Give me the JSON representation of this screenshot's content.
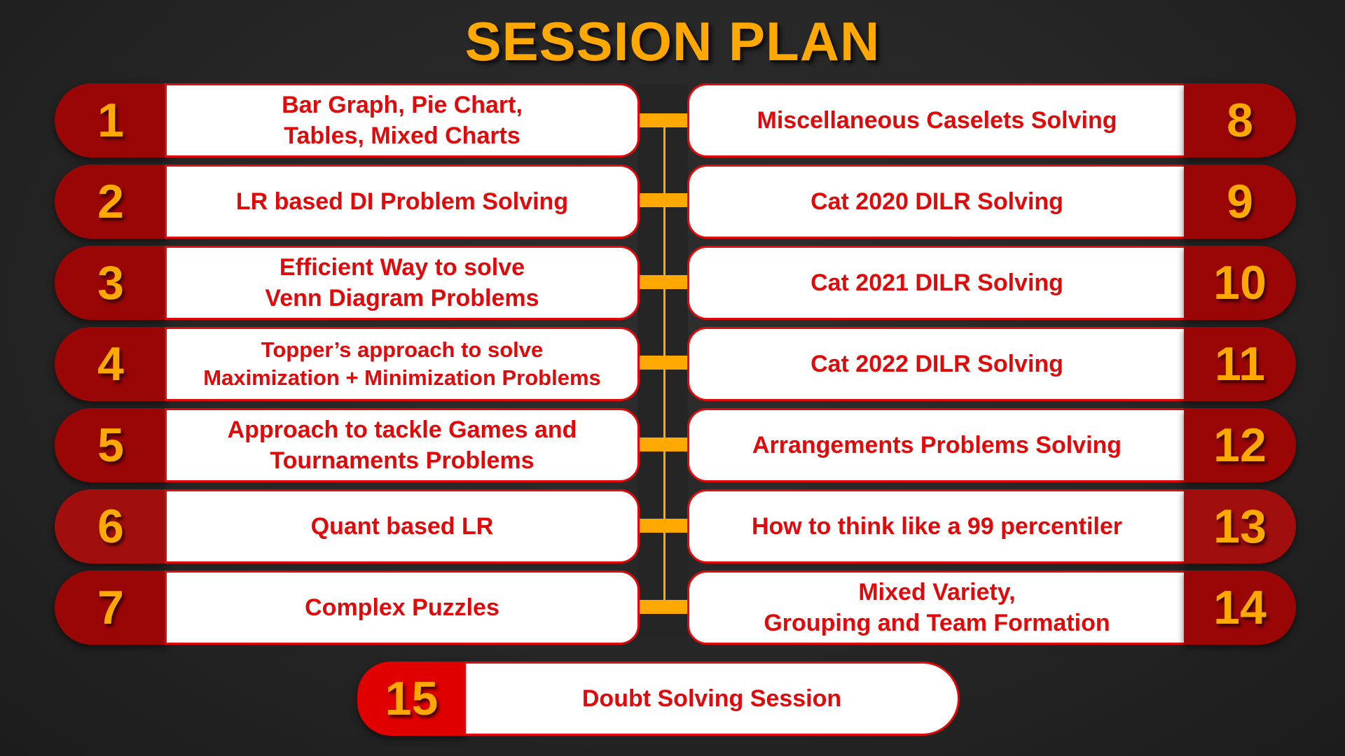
{
  "title": "SESSION PLAN",
  "colors": {
    "background": "#262626",
    "accent": "#ffa800",
    "badge": "#9a0606",
    "badge_final": "#e00000",
    "text": "#e00a0a",
    "box": "#ffffff"
  },
  "left_sessions": [
    {
      "number": "1",
      "label": "Bar Graph, Pie Chart,\nTables, Mixed Charts"
    },
    {
      "number": "2",
      "label": "LR based DI Problem Solving"
    },
    {
      "number": "3",
      "label": "Efficient Way to solve\nVenn Diagram Problems"
    },
    {
      "number": "4",
      "label": "Topper’s approach to solve\nMaximization + Minimization Problems"
    },
    {
      "number": "5",
      "label": "Approach to tackle Games and\nTournaments Problems"
    },
    {
      "number": "6",
      "label": "Quant based LR"
    },
    {
      "number": "7",
      "label": "Complex Puzzles"
    }
  ],
  "right_sessions": [
    {
      "number": "8",
      "label": "Miscellaneous Caselets Solving"
    },
    {
      "number": "9",
      "label": "Cat 2020 DILR Solving"
    },
    {
      "number": "10",
      "label": "Cat 2021 DILR Solving"
    },
    {
      "number": "11",
      "label": "Cat 2022 DILR Solving"
    },
    {
      "number": "12",
      "label": "Arrangements Problems Solving"
    },
    {
      "number": "13",
      "label": "How to think like a 99 percentiler"
    },
    {
      "number": "14",
      "label": "Mixed Variety,\nGrouping and Team Formation"
    }
  ],
  "final_session": {
    "number": "15",
    "label": "Doubt Solving Session"
  }
}
